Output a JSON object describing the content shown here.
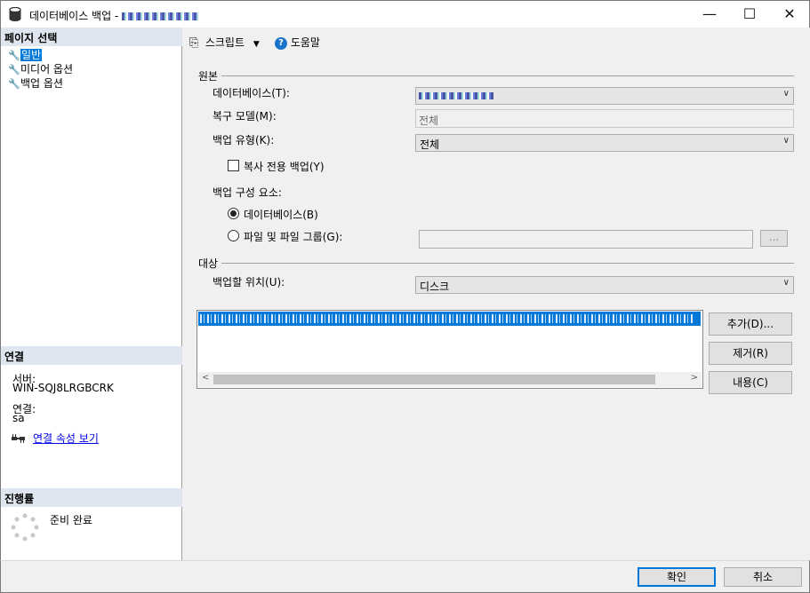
{
  "window": {
    "title": "데이터베이스 백업 - ",
    "controls": {
      "minimize": "—",
      "maximize": "☐",
      "close": "✕"
    }
  },
  "left": {
    "pages_header": "페이지 선택",
    "pages": [
      {
        "label": "일반",
        "selected": true
      },
      {
        "label": "미디어 옵션",
        "selected": false
      },
      {
        "label": "백업 옵션",
        "selected": false
      }
    ],
    "connection": {
      "header": "연결",
      "server_label": "서버:",
      "server_value": "WIN-SQJ8LRGBCRK",
      "conn_label": "연결:",
      "conn_value": "sa",
      "props_link": "연결 속성 보기"
    },
    "progress": {
      "header": "진행률",
      "status": "준비 완료"
    }
  },
  "toolbar": {
    "script_label": "스크립트",
    "help_label": "도움말"
  },
  "source": {
    "group_label": "원본",
    "database_label": "데이터베이스(T):",
    "recovery_label": "복구 모델(M):",
    "recovery_value": "전체",
    "backup_type_label": "백업 유형(K):",
    "backup_type_value": "전체",
    "copy_only_label": "복사 전용 백업(Y)",
    "component_label": "백업 구성 요소:",
    "radio_database": "데이터베이스(B)",
    "radio_files": "파일 및 파일 그룹(G):",
    "browse_label": "..."
  },
  "destination": {
    "group_label": "대상",
    "backup_to_label": "백업할 위치(U):",
    "backup_to_value": "디스크",
    "add_button": "추가(D)...",
    "remove_button": "제거(R)",
    "contents_button": "내용(C)"
  },
  "buttons": {
    "ok": "확인",
    "cancel": "취소"
  },
  "colors": {
    "accent": "#0078d7",
    "section_header_bg": "#dfe6ef"
  }
}
